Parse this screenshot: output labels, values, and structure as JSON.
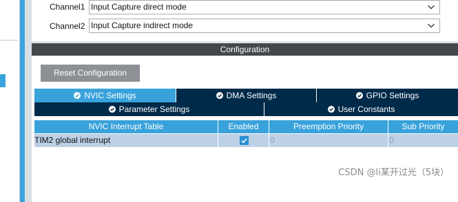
{
  "channels": [
    {
      "label": "Channel1",
      "value": "Input Capture direct mode"
    },
    {
      "label": "Channel2",
      "value": "Input Capture indirect mode"
    }
  ],
  "configuration": {
    "header": "Configuration",
    "reset_label": "Reset Configuration"
  },
  "tabs": [
    {
      "label": "NVIC Settings",
      "active": true
    },
    {
      "label": "DMA Settings",
      "active": false
    },
    {
      "label": "GPIO Settings",
      "active": false
    },
    {
      "label": "Parameter Settings",
      "active": false
    },
    {
      "label": "User Constants",
      "active": false
    }
  ],
  "nvic_table": {
    "columns": [
      "NVIC Interrupt Table",
      "Enabled",
      "Preemption Priority",
      "Sub Priority"
    ],
    "rows": [
      {
        "name": "TIM2 global interrupt",
        "enabled": true,
        "preemption": "0",
        "sub": "0"
      }
    ]
  },
  "watermark": "CSDN @li某开过光（5块）",
  "colors": {
    "accent": "#39a2db",
    "tab_dark": "#002a49",
    "header_bar": "#44484d",
    "row_bg": "#bcd0e6"
  }
}
